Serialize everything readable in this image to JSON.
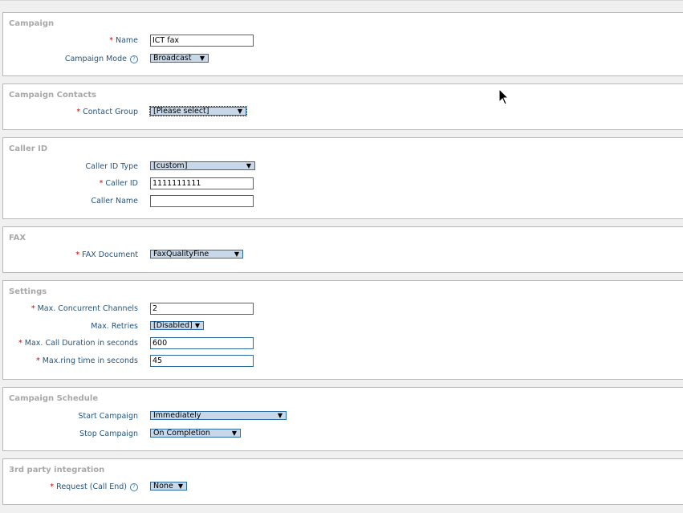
{
  "campaign": {
    "title": "Campaign",
    "name_label": "Name",
    "name_value": "ICT fax",
    "mode_label": "Campaign Mode",
    "mode_value": "Broadcast"
  },
  "contacts": {
    "title": "Campaign Contacts",
    "group_label": "Contact Group",
    "group_value": "[Please select]"
  },
  "callerid": {
    "title": "Caller ID",
    "type_label": "Caller ID Type",
    "type_value": "[custom]",
    "id_label": "Caller ID",
    "id_value": "1111111111",
    "name_label": "Caller Name",
    "name_value": ""
  },
  "fax": {
    "title": "FAX",
    "doc_label": "FAX Document",
    "doc_value": "FaxQualityFine"
  },
  "settings": {
    "title": "Settings",
    "channels_label": "Max. Concurrent Channels",
    "channels_value": "2",
    "retries_label": "Max. Retries",
    "retries_value": "[Disabled]",
    "duration_label": "Max. Call Duration in seconds",
    "duration_value": "600",
    "ring_label": "Max.ring time in seconds",
    "ring_value": "45"
  },
  "schedule": {
    "title": "Campaign Schedule",
    "start_label": "Start Campaign",
    "start_value": "Immediately",
    "stop_label": "Stop Campaign",
    "stop_value": "On Completion"
  },
  "integration": {
    "title": "3rd party integration",
    "request_label": "Request (Call End)",
    "request_value": "None"
  },
  "icons": {
    "required_mark": "*",
    "help_icon": "?",
    "dropdown_arrow": "▼"
  }
}
